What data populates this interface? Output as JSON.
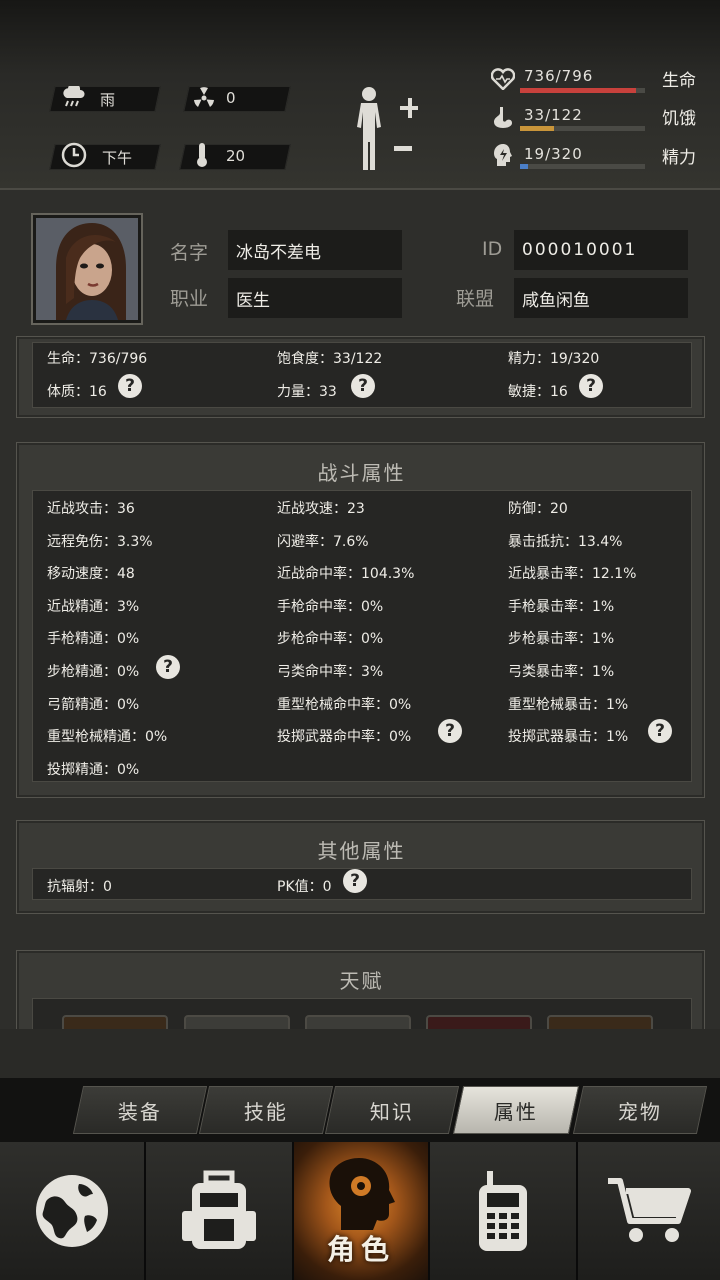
{
  "top": {
    "weather": "雨",
    "radiation": "0",
    "time": "下午",
    "temperature": "20",
    "bars": [
      {
        "value": "736/796",
        "label": "生命",
        "fraction": 0.925,
        "color": "#c8413c"
      },
      {
        "value": "33/122",
        "label": "饥饿",
        "fraction": 0.27,
        "color": "#c9953a"
      },
      {
        "value": "19/320",
        "label": "精力",
        "fraction": 0.06,
        "color": "#4b7fc8"
      }
    ]
  },
  "profile": {
    "name_label": "名字",
    "name": "冰岛不差电",
    "id_label": "ID",
    "id": "000010001",
    "job_label": "职业",
    "job": "医生",
    "alliance_label": "联盟",
    "alliance": "咸鱼闲鱼"
  },
  "basic": [
    "生命：736/796",
    "饱食度：33/122",
    "精力：19/320",
    "体质：16",
    "力量：33",
    "敏捷：16"
  ],
  "combat": {
    "title": "战斗属性",
    "rows": [
      [
        "近战攻击：36",
        "近战攻速：23",
        "防御：20"
      ],
      [
        "远程免伤：3.3%",
        "闪避率：7.6%",
        "暴击抵抗：13.4%"
      ],
      [
        "移动速度：48",
        "近战命中率：104.3%",
        "近战暴击率：12.1%"
      ],
      [
        "近战精通：3%",
        "手枪命中率：0%",
        "手枪暴击率：1%"
      ],
      [
        "手枪精通：0%",
        "步枪命中率：0%",
        "步枪暴击率：1%"
      ],
      [
        "步枪精通：0%",
        "弓类命中率：3%",
        "弓类暴击率：1%"
      ],
      [
        "弓箭精通：0%",
        "重型枪械命中率：0%",
        "重型枪械暴击：1%"
      ],
      [
        "重型枪械精通：0%",
        "投掷武器命中率：0%",
        "投掷武器暴击：1%"
      ],
      [
        "投掷精通：0%",
        "",
        ""
      ]
    ]
  },
  "other": {
    "title": "其他属性",
    "items": [
      "抗辐射：0",
      "PK值：0"
    ]
  },
  "talent": {
    "title": "天赋"
  },
  "help_glyph": "?",
  "tabs": [
    "装备",
    "技能",
    "知识",
    "属性",
    "宠物"
  ],
  "active_tab": "属性",
  "nav": {
    "active_label": "角色"
  }
}
